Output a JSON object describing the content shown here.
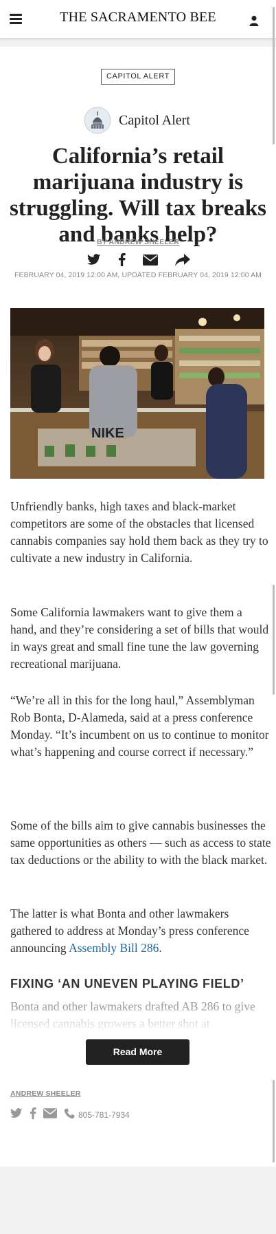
{
  "header": {
    "masthead": "THE SACRAMENTO BEE",
    "menu_icon": "hamburger-icon",
    "user_icon": "user-icon"
  },
  "article": {
    "section_tag": "CAPITOL ALERT",
    "brand_name": "Capitol Alert",
    "headline": "California’s retail marijuana industry is struggling. Will tax breaks and banks help?",
    "byline": "BY ANDREW SHEELER",
    "share_icons": [
      "twitter-icon",
      "facebook-icon",
      "email-icon",
      "share-icon"
    ],
    "dateline": "FEBRUARY 04, 2019 12:00 AM,  UPDATED FEBRUARY 04, 2019 12:00 AM",
    "paragraphs": [
      "Unfriendly banks, high taxes and black-market competitors are some of the obstacles that licensed cannabis companies say hold them back as they try to cultivate a new industry in California.",
      "Some California lawmakers want to give them a hand, and they’re considering a set of bills that would in ways great and small fine tune the law governing recreational marijuana.",
      "“We’re all in this for the long haul,” Assemblyman Rob Bonta, D-Alameda, said at a press conference Monday. “It’s incumbent on us to continue to monitor what’s happening and course correct if necessary.”",
      "Some of the bills aim to give cannabis businesses the same opportunities as others — such as access to state tax deductions or the ability to with the black market."
    ],
    "para5_prefix": "The latter is what Bonta and other lawmakers gathered to address at Monday’s press conference announcing ",
    "para5_link": "Assembly Bill 286",
    "para5_suffix": ".",
    "subhead": "FIXING ‘AN UNEVEN PLAYING FIELD’",
    "faded_paragraph": "Bonta and other lawmakers drafted AB 286 to give licensed cannabis growers a better shot at",
    "read_more": "Read More"
  },
  "footer": {
    "author": "ANDREW SHEELER",
    "phone": "805-781-7934",
    "contact_icons": [
      "twitter-icon",
      "facebook-icon",
      "email-icon",
      "phone-icon"
    ]
  },
  "colors": {
    "link": "#1a67a3",
    "button_bg": "#222222",
    "meta_gray": "#888888"
  }
}
